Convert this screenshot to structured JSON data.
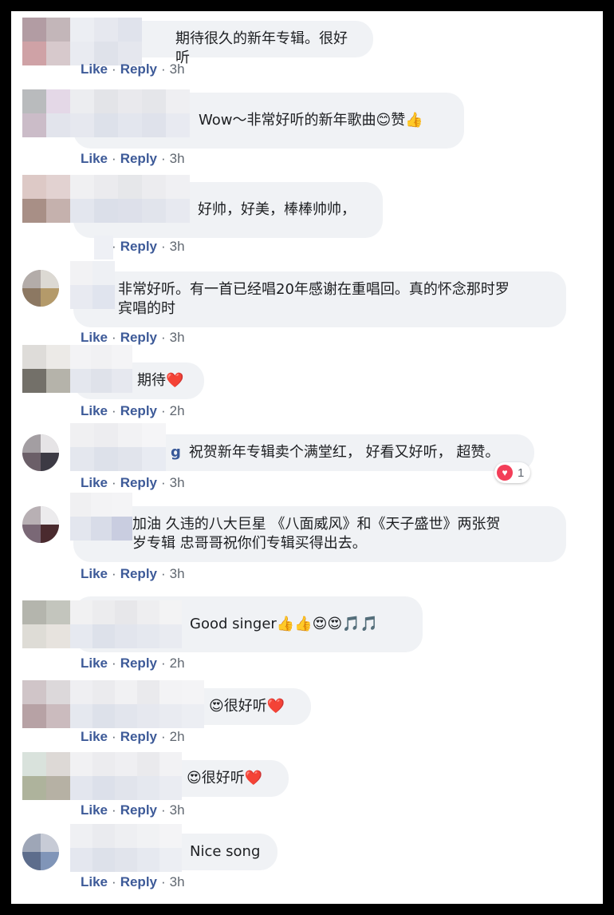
{
  "actions": {
    "like": "Like",
    "reply": "Reply",
    "dot": "·"
  },
  "comments": [
    {
      "text": "期待很久的新年专辑。很好听",
      "time": "3h"
    },
    {
      "text": "Wow～非常好听的新年歌曲😊赞👍",
      "time": "3h"
    },
    {
      "text": "好帅，好美，棒棒帅帅，",
      "time": "3h"
    },
    {
      "text": "非常好听。有一首已经唱20年感谢在重唱回。真的怀念那时罗\n宾唱的时",
      "time": "3h"
    },
    {
      "text": "期待❤️",
      "time": "2h"
    },
    {
      "name_fragment": "g",
      "text": "祝贺新年专辑卖个满堂红， 好看又好听， 超赞。",
      "time": "3h",
      "reaction_count": "1"
    },
    {
      "text": "加油 久违的八大巨星 《八面威风》和《天子盛世》两张贺\n岁专辑 忠哥哥祝你们专辑买得出去。",
      "time": "3h"
    },
    {
      "text": "Good singer👍👍😍😍🎵🎵",
      "time": "2h"
    },
    {
      "text": "😍很好听❤️",
      "time": "2h"
    },
    {
      "text": "😍很好听❤️",
      "time": "3h"
    },
    {
      "text": "Nice song",
      "time": "3h"
    }
  ],
  "colors": {
    "link": "#3d5a98",
    "meta": "#606770",
    "bubble": "#f0f2f5",
    "heart": "#f33e58"
  }
}
